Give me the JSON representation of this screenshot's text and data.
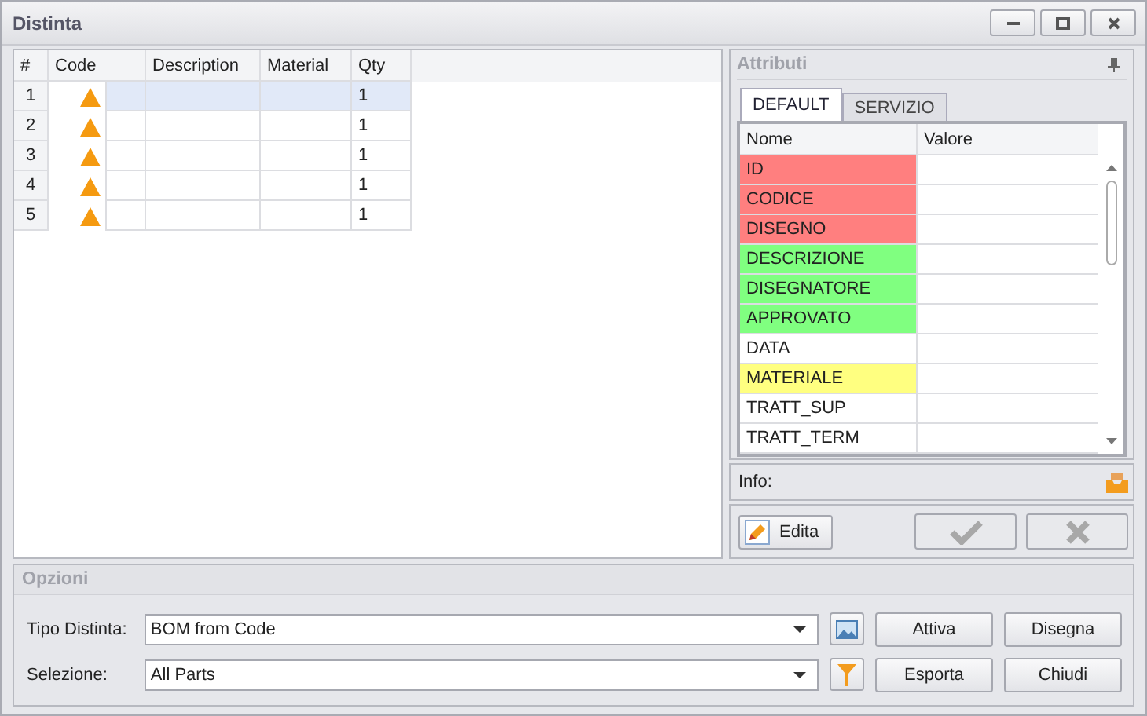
{
  "window": {
    "title": "Distinta"
  },
  "grid": {
    "columns": [
      "#",
      "Code",
      "Description",
      "Material",
      "Qty"
    ],
    "rows": [
      {
        "number": "1",
        "qty": "1",
        "selected": true
      },
      {
        "number": "2",
        "qty": "1",
        "selected": false
      },
      {
        "number": "3",
        "qty": "1",
        "selected": false
      },
      {
        "number": "4",
        "qty": "1",
        "selected": false
      },
      {
        "number": "5",
        "qty": "1",
        "selected": false
      }
    ]
  },
  "attributes": {
    "title": "Attributi",
    "tabs": [
      {
        "label": "DEFAULT",
        "selected": true
      },
      {
        "label": "SERVIZIO",
        "selected": false
      }
    ],
    "columns": [
      "Nome",
      "Valore"
    ],
    "rows": [
      {
        "name": "ID",
        "color": "#ff7f7f"
      },
      {
        "name": "CODICE",
        "color": "#ff7f7f"
      },
      {
        "name": "DISEGNO",
        "color": "#ff7f7f"
      },
      {
        "name": "DESCRIZIONE",
        "color": "#80ff80"
      },
      {
        "name": "DISEGNATORE",
        "color": "#80ff80"
      },
      {
        "name": "APPROVATO",
        "color": "#80ff80"
      },
      {
        "name": "DATA",
        "color": "#ffffff"
      },
      {
        "name": "MATERIALE",
        "color": "#ffff80"
      },
      {
        "name": "TRATT_SUP",
        "color": "#ffffff"
      },
      {
        "name": "TRATT_TERM",
        "color": "#ffffff"
      }
    ],
    "info_label": "Info:",
    "edit_button": "Edita",
    "confirm_disabled": true,
    "cancel_disabled": true
  },
  "options": {
    "title": "Opzioni",
    "fields": [
      {
        "label": "Tipo Distinta:",
        "value": "BOM from Code",
        "kind": "image"
      },
      {
        "label": "Selezione:",
        "value": "All Parts",
        "kind": "filter"
      }
    ],
    "buttons": [
      [
        "Attiva",
        "Disegna"
      ],
      [
        "Esporta",
        "Chiudi"
      ]
    ]
  }
}
